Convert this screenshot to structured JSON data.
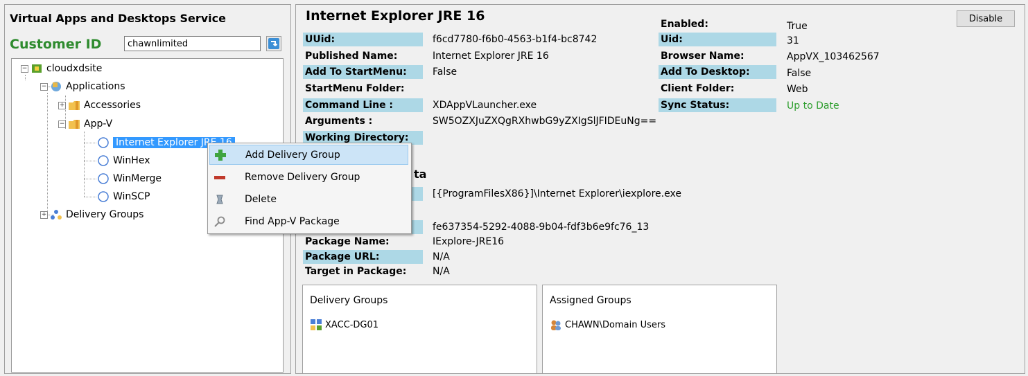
{
  "service_title": "Virtual Apps and Desktops Service",
  "customer": {
    "label": "Customer ID",
    "value": "chawnlimited"
  },
  "tree": {
    "root": "cloudxdsite",
    "applications": "Applications",
    "accessories": "Accessories",
    "appv": "App-V",
    "apps": [
      "Internet Explorer JRE 16",
      "WinHex",
      "WinMerge",
      "WinSCP"
    ],
    "delivery_groups": "Delivery Groups"
  },
  "context_menu": {
    "items": [
      "Add Delivery Group",
      "Remove Delivery Group",
      "Delete",
      "Find App-V Package"
    ]
  },
  "details": {
    "title": "Internet Explorer JRE 16",
    "disable_label": "Disable",
    "left_fields": [
      {
        "label": "UUid:",
        "value": "f6cd7780-f6b0-4563-b1f4-bc8742"
      },
      {
        "label": "Published Name:",
        "value": "Internet Explorer JRE 16"
      },
      {
        "label": "Add To StartMenu:",
        "value": "False"
      },
      {
        "label": "StartMenu Folder:",
        "value": ""
      },
      {
        "label": "Command Line :",
        "value": "XDAppVLauncher.exe"
      },
      {
        "label": "Arguments :",
        "value": "SW5OZXJuZXQgRXhwbG9yZXIgSlJFIDEuNg=="
      },
      {
        "label": "Working Directory:",
        "value": ""
      }
    ],
    "section_fragment": "ta",
    "path_value": "[{ProgramFilesX86}]\\Internet Explorer\\iexplore.exe",
    "package_id_value": "fe637354-5292-4088-9b04-fdf3b6e9fc76_13",
    "package_fields": [
      {
        "label": "Package Name:",
        "value": "IExplore-JRE16"
      },
      {
        "label": "Package URL:",
        "value": "N/A"
      },
      {
        "label": "Target in Package:",
        "value": "N/A"
      }
    ],
    "right_fields": [
      {
        "label": "Enabled:",
        "value": "True"
      },
      {
        "label": "Uid:",
        "value": "31"
      },
      {
        "label": "Browser Name:",
        "value": "AppVX_103462567"
      },
      {
        "label": "Add To Desktop:",
        "value": "False"
      },
      {
        "label": "Client Folder:",
        "value": "Web"
      },
      {
        "label": "Sync Status:",
        "value": "Up to Date"
      }
    ],
    "sync_color": "#2e9e2e",
    "delivery_groups_box": {
      "title": "Delivery Groups",
      "items": [
        "XACC-DG01"
      ]
    },
    "assigned_groups_box": {
      "title": "Assigned Groups",
      "items": [
        "CHAWN\\Domain Users"
      ]
    }
  }
}
